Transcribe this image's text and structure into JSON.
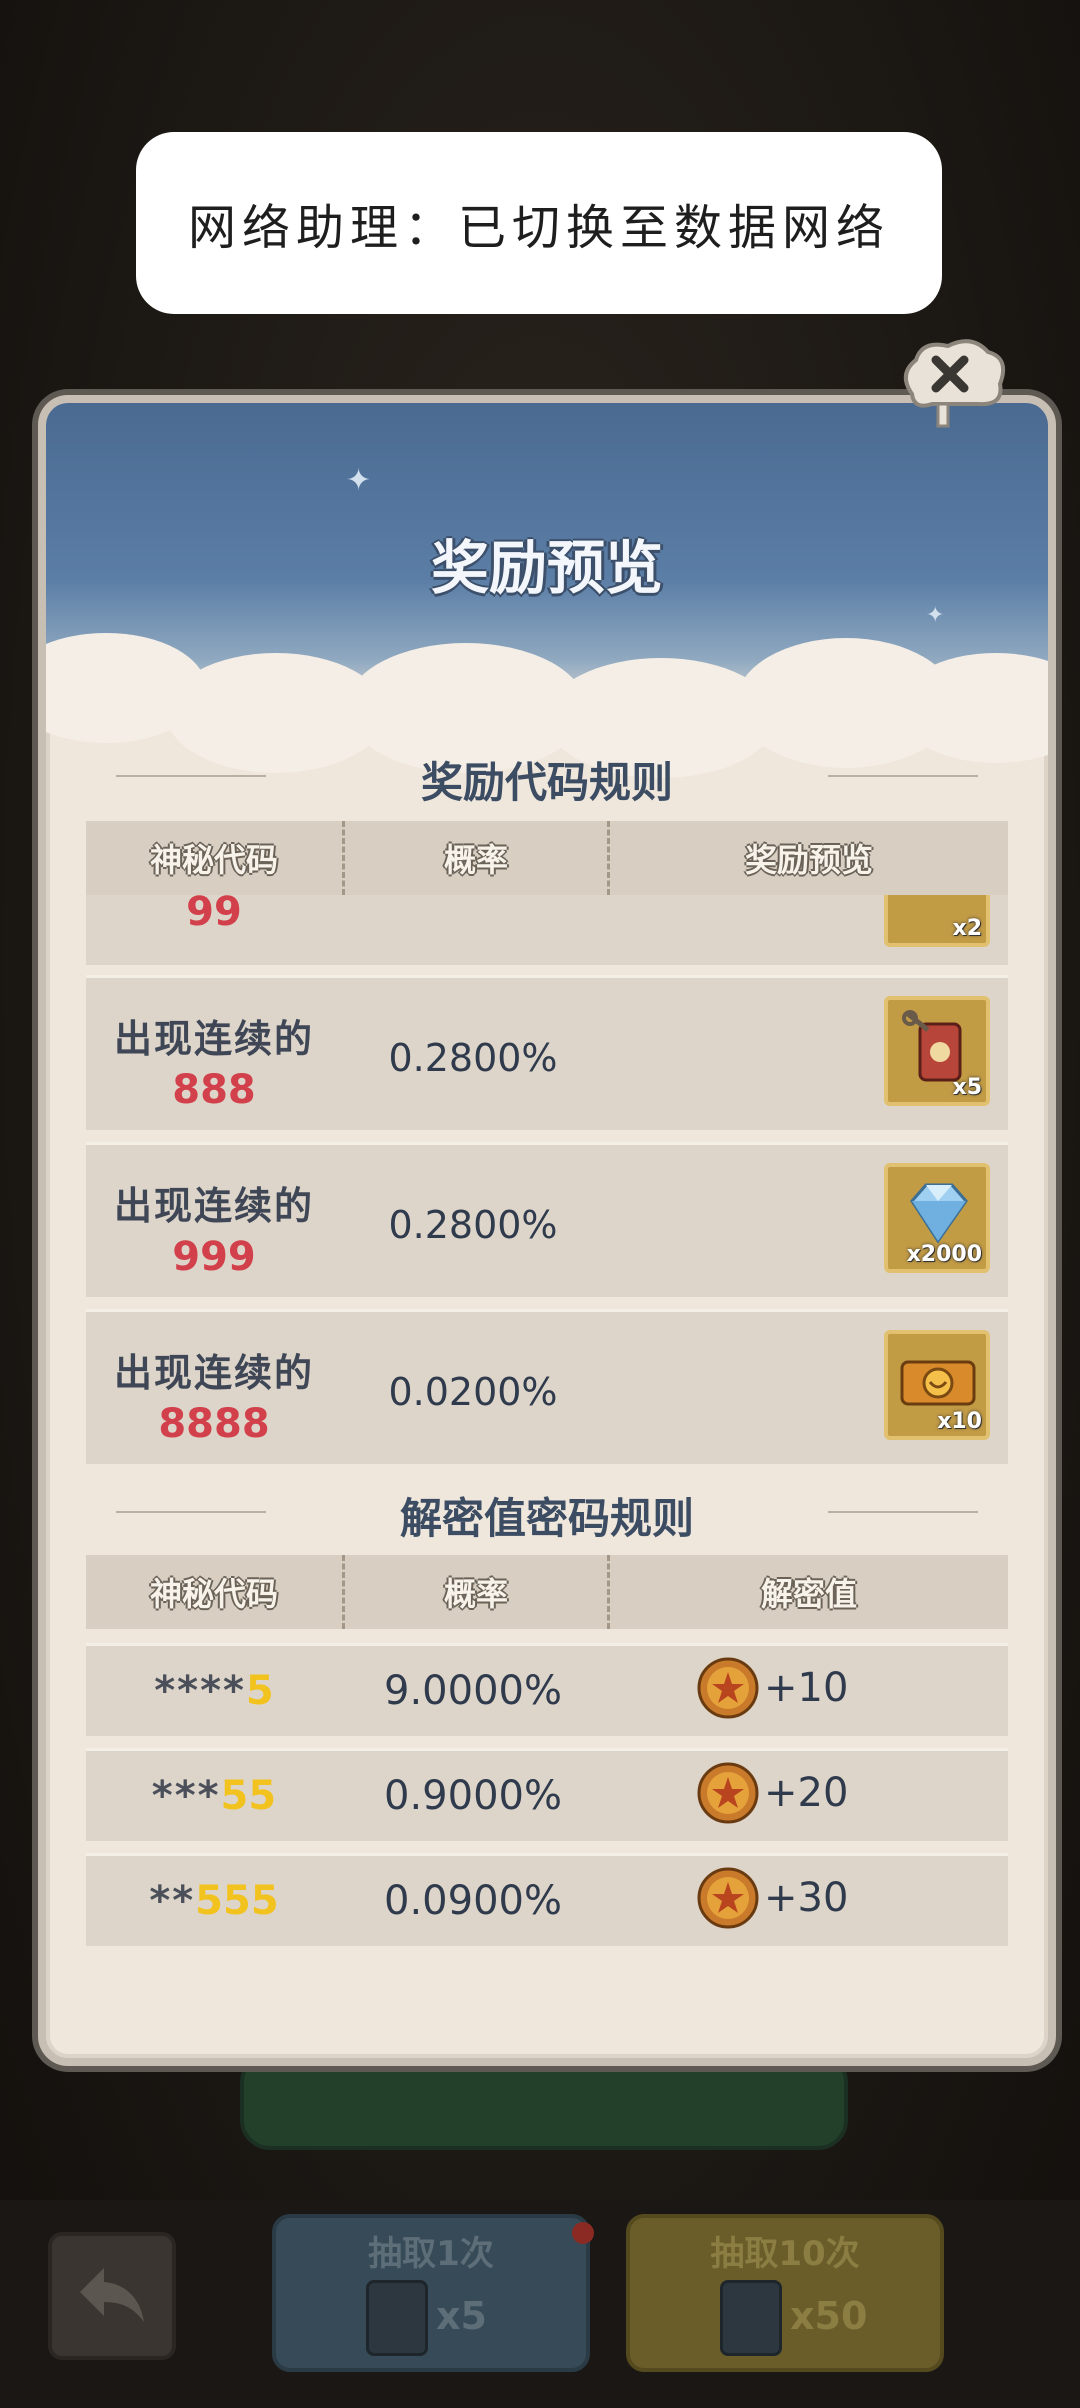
{
  "toast": {
    "text": "网络助理：已切换至数据网络"
  },
  "panel": {
    "title": "奖励预览",
    "reward_section": {
      "title": "奖励代码规则",
      "headers": [
        "神秘代码",
        "概率",
        "奖励预览"
      ],
      "partial_row": {
        "code_number": "99",
        "reward_qty": "x2"
      },
      "rows": [
        {
          "code_label": "出现连续的",
          "code_number": "888",
          "probability": "0.2800%",
          "reward_icon": "tag-charm-icon",
          "reward_qty": "x5"
        },
        {
          "code_label": "出现连续的",
          "code_number": "999",
          "probability": "0.2800%",
          "reward_icon": "diamond-icon",
          "reward_qty": "x2000"
        },
        {
          "code_label": "出现连续的",
          "code_number": "8888",
          "probability": "0.0200%",
          "reward_icon": "golden-ticket-icon",
          "reward_qty": "x10"
        }
      ]
    },
    "decrypt_section": {
      "title": "解密值密码规则",
      "headers": [
        "神秘代码",
        "概率",
        "解密值"
      ],
      "rows": [
        {
          "code_stars": "****",
          "code_digits": "5",
          "probability": "9.0000%",
          "value": "+10"
        },
        {
          "code_stars": "***",
          "code_digits": "55",
          "probability": "0.9000%",
          "value": "+20"
        },
        {
          "code_stars": "**",
          "code_digits": "555",
          "probability": "0.0900%",
          "value": "+30"
        }
      ]
    }
  },
  "bottom": {
    "draw_one_label": "抽取1次",
    "draw_one_cost": "x5",
    "draw_ten_label": "抽取10次",
    "draw_ten_cost": "x50"
  },
  "colors": {
    "accent_red": "#d2404b",
    "accent_yellow": "#f2c21f",
    "header_blue": "#5b7ea6"
  }
}
